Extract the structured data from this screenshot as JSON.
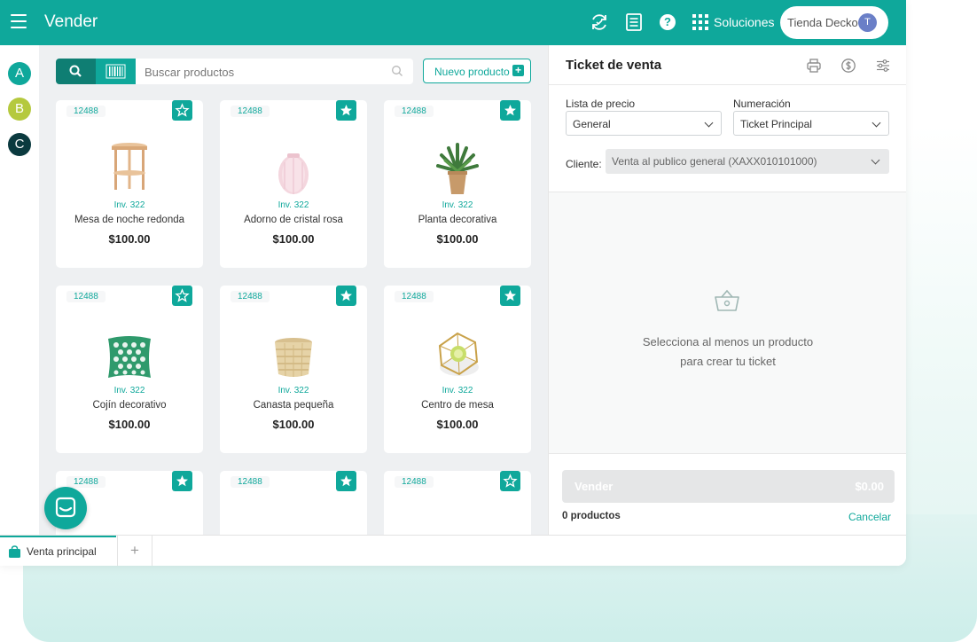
{
  "header": {
    "title": "Vender",
    "solutions_label": "Soluciones",
    "help_label": "?",
    "store_name": "Tienda Decko",
    "avatar_initial": "T",
    "brand_color": "#0fa89b"
  },
  "rail": {
    "accounts": [
      {
        "letter": "A",
        "color": "#0fa89b"
      },
      {
        "letter": "B",
        "color": "#b5c93e"
      },
      {
        "letter": "C",
        "color": "#0b3a3f"
      }
    ]
  },
  "catalog": {
    "search_placeholder": "Buscar productos",
    "new_product_label": "Nuevo producto",
    "new_product_plus": "+",
    "products": [
      {
        "code": "12488",
        "inventory": "Inv. 322",
        "name": "Mesa de noche redonda",
        "price": "$100.00",
        "favorite": false,
        "icon": "side-table"
      },
      {
        "code": "12488",
        "inventory": "Inv. 322",
        "name": "Adorno de cristal rosa",
        "price": "$100.00",
        "favorite": true,
        "icon": "pink-vase"
      },
      {
        "code": "12488",
        "inventory": "Inv. 322",
        "name": "Planta decorativa",
        "price": "$100.00",
        "favorite": true,
        "icon": "potted-plant"
      },
      {
        "code": "12488",
        "inventory": "Inv. 322",
        "name": "Cojín decorativo",
        "price": "$100.00",
        "favorite": false,
        "icon": "cushion"
      },
      {
        "code": "12488",
        "inventory": "Inv. 322",
        "name": "Canasta pequeña",
        "price": "$100.00",
        "favorite": true,
        "icon": "basket"
      },
      {
        "code": "12488",
        "inventory": "Inv. 322",
        "name": "Centro de mesa",
        "price": "$100.00",
        "favorite": true,
        "icon": "geometric-centerpiece"
      },
      {
        "code": "12488",
        "favorite": true,
        "icon": "yellow-lamp"
      },
      {
        "code": "12488",
        "favorite": true,
        "icon": "plant"
      },
      {
        "code": "12488",
        "favorite": false,
        "icon": "side-table"
      }
    ]
  },
  "ticket": {
    "title": "Ticket de venta",
    "price_list_label": "Lista de precio",
    "price_list_value": "General",
    "numbering_label": "Numeración",
    "numbering_value": "Ticket Principal",
    "client_label": "Cliente:",
    "client_value": "Venta al publico general (XAXX010101000)",
    "empty_line1": "Selecciona al menos un producto",
    "empty_line2": "para crear tu ticket",
    "sell_label": "Vender",
    "sell_total": "$0.00",
    "product_count": "0 productos",
    "cancel_label": "Cancelar"
  },
  "tabs": {
    "active_label": "Venta principal",
    "add_label": "+"
  }
}
